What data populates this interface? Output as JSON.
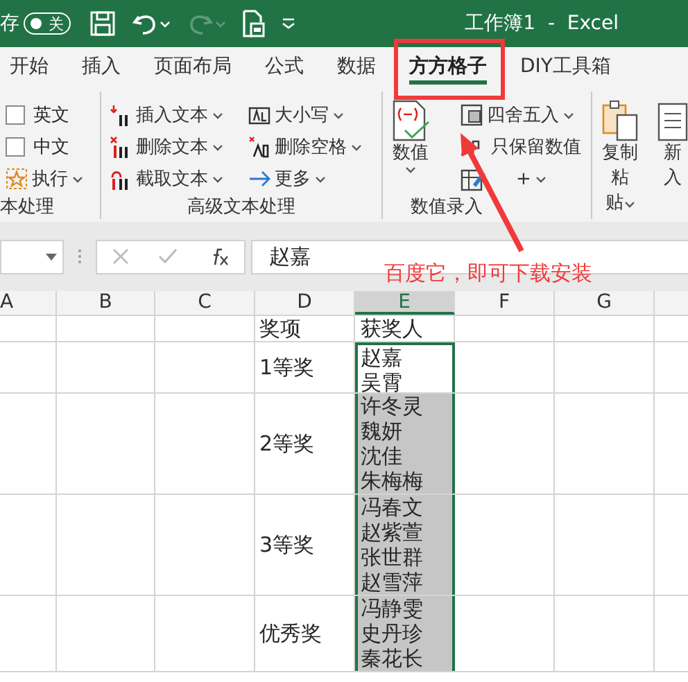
{
  "title_bar": {
    "autosave_label": "存",
    "autosave": {
      "label": "关",
      "on": false
    },
    "redo_disabled": true,
    "title": "工作簿1  -  Excel"
  },
  "tabs": [
    {
      "label": "开始",
      "selected": false
    },
    {
      "label": "插入",
      "selected": false
    },
    {
      "label": "页面布局",
      "selected": false
    },
    {
      "label": "公式",
      "selected": false
    },
    {
      "label": "数据",
      "selected": false
    },
    {
      "label": "方方格子",
      "selected": true
    },
    {
      "label": "DIY工具箱",
      "selected": false
    }
  ],
  "ribbon": {
    "groups": [
      {
        "label": "本处理",
        "columns": [
          [
            {
              "kind": "checkbox",
              "label": "英文",
              "checked": false
            },
            {
              "kind": "checkbox",
              "label": "中文",
              "checked": false
            },
            {
              "kind": "menu",
              "label": "执行"
            }
          ]
        ]
      },
      {
        "label": "高级文本处理",
        "columns": [
          [
            {
              "kind": "menu",
              "label": "插入文本"
            },
            {
              "kind": "menu",
              "label": "删除文本"
            },
            {
              "kind": "menu",
              "label": "截取文本"
            }
          ],
          [
            {
              "kind": "menu",
              "label": "大小写"
            },
            {
              "kind": "menu",
              "label": "删除空格"
            },
            {
              "kind": "menu",
              "label": "更多"
            }
          ]
        ]
      },
      {
        "label": "数值录入",
        "columns": [
          [
            {
              "kind": "large",
              "lines": [
                "数值"
              ],
              "caret": true
            }
          ],
          [
            {
              "kind": "menu",
              "label": "四舍五入"
            },
            {
              "kind": "button",
              "label": "只保留数值"
            },
            {
              "kind": "edit_menu",
              "label": "+"
            }
          ]
        ]
      },
      {
        "columns": [
          [
            {
              "kind": "large",
              "lines": [
                "复制粘",
                "贴"
              ],
              "caret": true
            }
          ],
          [
            {
              "kind": "large",
              "lines": [
                "新",
                "入"
              ],
              "caret": false
            }
          ]
        ]
      }
    ]
  },
  "formula_bar": {
    "value": "赵嘉"
  },
  "sheet": {
    "columns": [
      {
        "label": "A",
        "selected": false
      },
      {
        "label": "B",
        "selected": false
      },
      {
        "label": "C",
        "selected": false
      },
      {
        "label": "D",
        "selected": false
      },
      {
        "label": "E",
        "selected": true
      },
      {
        "label": "F",
        "selected": false
      },
      {
        "label": "G",
        "selected": false
      }
    ],
    "rows": [
      {
        "award": "奖项",
        "winners": [
          "获奖人"
        ],
        "selected": false,
        "active": false
      },
      {
        "award": "1等奖",
        "winners": [
          "赵嘉",
          "吴霄"
        ],
        "selected": true,
        "active": true
      },
      {
        "award": "2等奖",
        "winners": [
          "许冬灵",
          "魏妍",
          "沈佳",
          "朱梅梅"
        ],
        "selected": true,
        "active": false
      },
      {
        "award": "3等奖",
        "winners": [
          "冯春文",
          "赵紫萱",
          "张世群",
          "赵雪萍"
        ],
        "selected": true,
        "active": false
      },
      {
        "award": "优秀奖",
        "winners": [
          "冯静雯",
          "史丹珍",
          "秦花长"
        ],
        "selected": true,
        "active": false
      }
    ]
  },
  "annotation": {
    "text": "百度它，即可下载安装"
  }
}
